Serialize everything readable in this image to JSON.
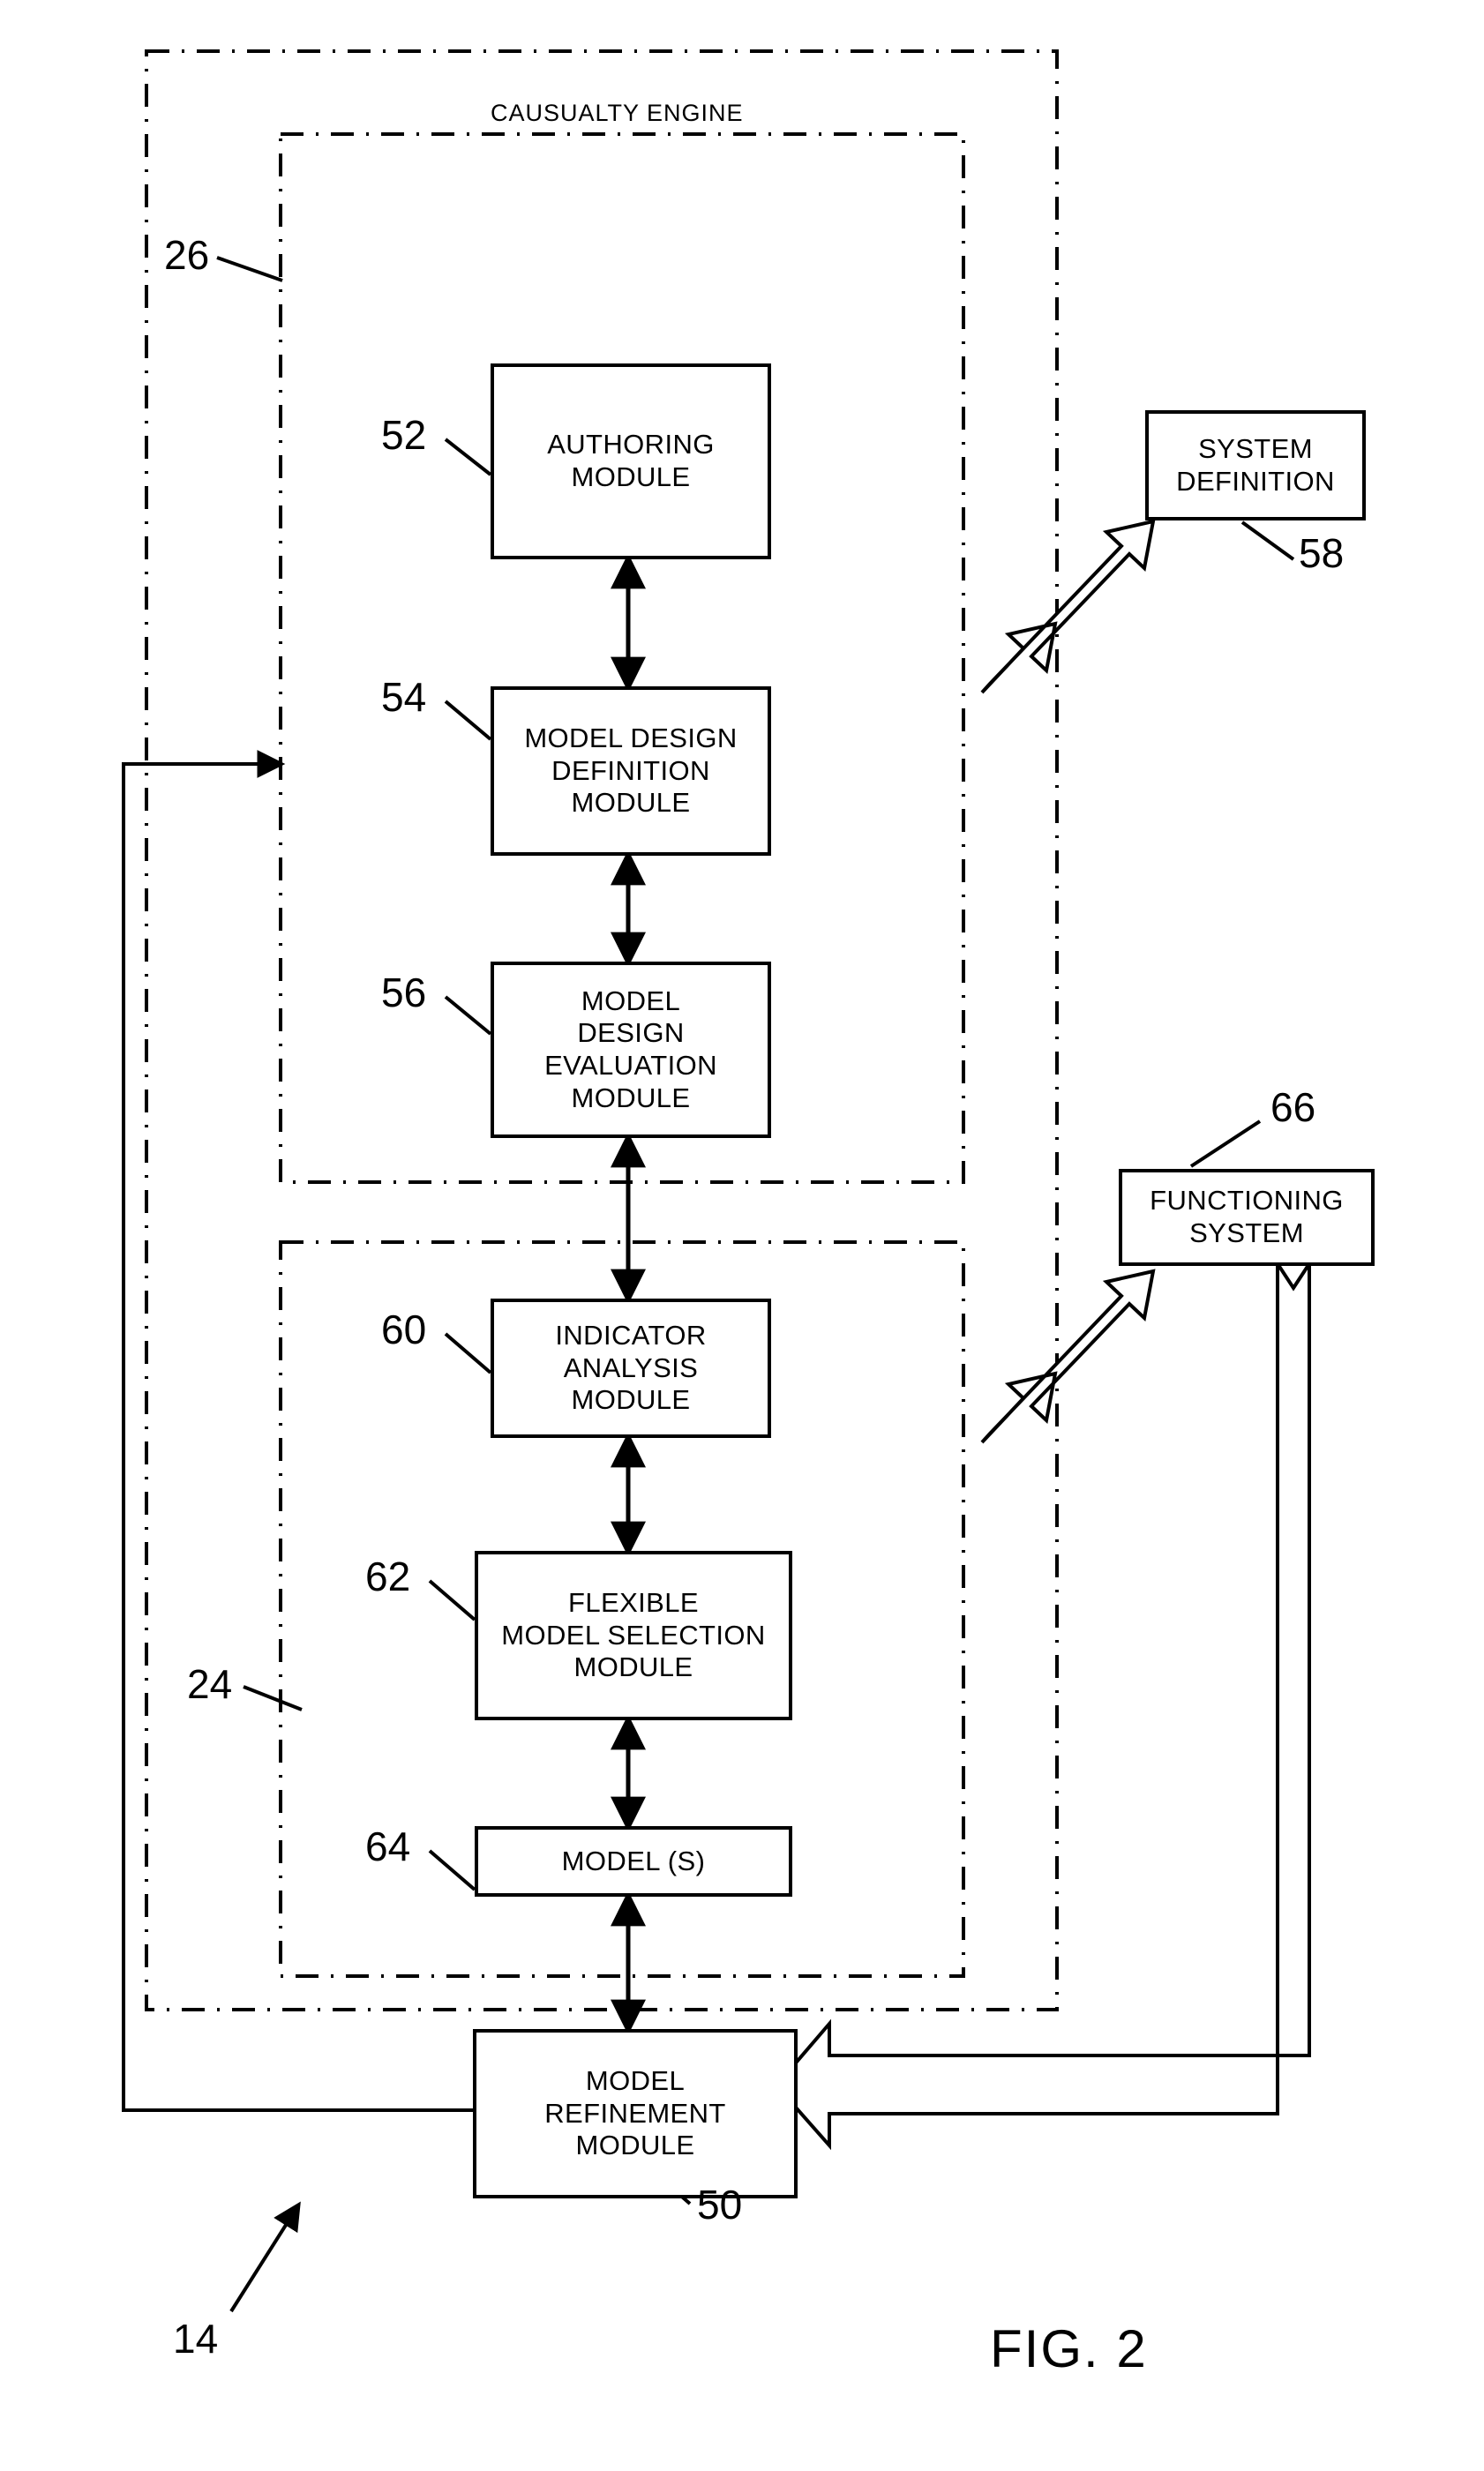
{
  "figure": {
    "caption": "FIG. 2",
    "overall_ref": "14"
  },
  "regions": [
    {
      "id": "outer-region",
      "title": "",
      "ref": "26"
    },
    {
      "id": "causualty-engine-region",
      "title": "CAUSUALTY ENGINE",
      "ref": ""
    },
    {
      "id": "inner-lower-region",
      "title": "",
      "ref": "24"
    }
  ],
  "region_title": "CAUSUALTY ENGINE",
  "refs": {
    "outer": "26",
    "inner": "24",
    "overall": "14",
    "authoring": "52",
    "model_design_definition": "54",
    "model_design_evaluation": "56",
    "system_definition": "58",
    "indicator_analysis": "60",
    "flexible_model_selection": "62",
    "models": "64",
    "model_refinement": "50",
    "functioning_system": "66"
  },
  "nodes": [
    {
      "id": "authoring-module",
      "ref": "52",
      "lines": [
        "AUTHORING",
        "MODULE"
      ]
    },
    {
      "id": "model-design-definition-module",
      "ref": "54",
      "lines": [
        "MODEL DESIGN",
        "DEFINITION",
        "MODULE"
      ]
    },
    {
      "id": "model-design-evaluation-module",
      "ref": "56",
      "lines": [
        "MODEL",
        "DESIGN",
        "EVALUATION",
        "MODULE"
      ]
    },
    {
      "id": "indicator-analysis-module",
      "ref": "60",
      "lines": [
        "INDICATOR",
        "ANALYSIS",
        "MODULE"
      ]
    },
    {
      "id": "flexible-model-selection-module",
      "ref": "62",
      "lines": [
        "FLEXIBLE",
        "MODEL SELECTION",
        "MODULE"
      ]
    },
    {
      "id": "models",
      "ref": "64",
      "lines": [
        "MODEL (S)"
      ]
    },
    {
      "id": "model-refinement-module",
      "ref": "50",
      "lines": [
        "MODEL",
        "REFINEMENT",
        "MODULE"
      ]
    },
    {
      "id": "system-definition",
      "ref": "58",
      "lines": [
        "SYSTEM",
        "DEFINITION"
      ]
    },
    {
      "id": "functioning-system",
      "ref": "66",
      "lines": [
        "FUNCTIONING",
        "SYSTEM"
      ]
    }
  ],
  "node_text": {
    "authoring_l1": "AUTHORING",
    "authoring_l2": "MODULE",
    "mdd_l1": "MODEL DESIGN",
    "mdd_l2": "DEFINITION",
    "mdd_l3": "MODULE",
    "mde_l1": "MODEL",
    "mde_l2": "DESIGN",
    "mde_l3": "EVALUATION",
    "mde_l4": "MODULE",
    "ia_l1": "INDICATOR",
    "ia_l2": "ANALYSIS",
    "ia_l3": "MODULE",
    "fms_l1": "FLEXIBLE",
    "fms_l2": "MODEL SELECTION",
    "fms_l3": "MODULE",
    "models_l1": "MODEL (S)",
    "mrm_l1": "MODEL",
    "mrm_l2": "REFINEMENT",
    "mrm_l3": "MODULE",
    "sysdef_l1": "SYSTEM",
    "sysdef_l2": "DEFINITION",
    "funcsys_l1": "FUNCTIONING",
    "funcsys_l2": "SYSTEM"
  },
  "colors": {
    "ink": "#000000",
    "paper": "#ffffff"
  }
}
